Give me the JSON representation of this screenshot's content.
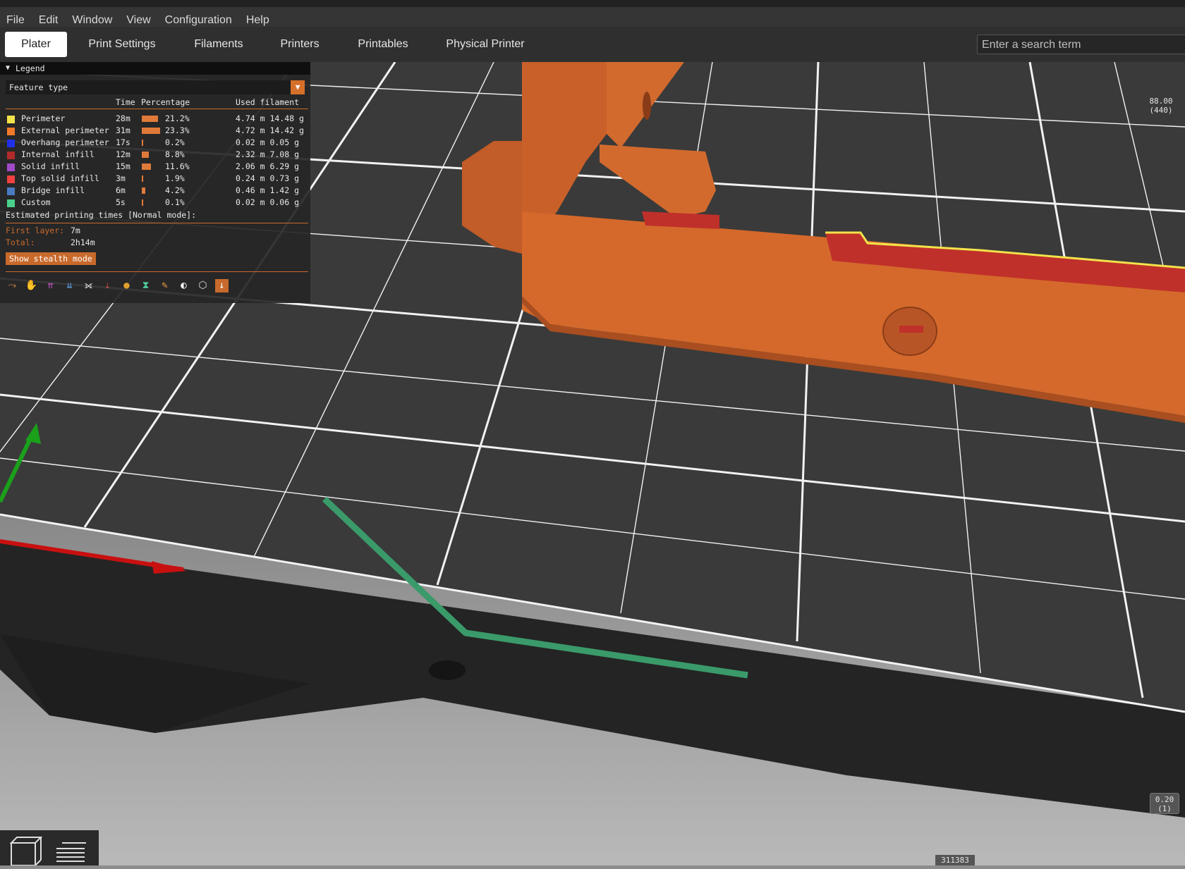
{
  "menu": [
    "File",
    "Edit",
    "Window",
    "View",
    "Configuration",
    "Help"
  ],
  "tabs": [
    "Plater",
    "Print Settings",
    "Filaments",
    "Printers",
    "Printables",
    "Physical Printer"
  ],
  "search": {
    "placeholder": "Enter a search term"
  },
  "legend": {
    "title": "Legend",
    "combo": "Feature type",
    "headers": {
      "time": "Time",
      "percentage": "Percentage",
      "used": "Used filament"
    },
    "rows": [
      {
        "name": "Perimeter",
        "time": "28m",
        "pct": "21.2%",
        "pct_value": 21.2,
        "filament": "4.74 m 14.48 g",
        "color": "#f2e34a"
      },
      {
        "name": "External perimeter",
        "time": "31m",
        "pct": "23.3%",
        "pct_value": 23.3,
        "filament": "4.72 m 14.42 g",
        "color": "#f07a2a"
      },
      {
        "name": "Overhang perimeter",
        "time": "17s",
        "pct": "0.2%",
        "pct_value": 0.2,
        "filament": "0.02 m 0.05 g",
        "color": "#2030e8"
      },
      {
        "name": "Internal infill",
        "time": "12m",
        "pct": "8.8%",
        "pct_value": 8.8,
        "filament": "2.32 m 7.08 g",
        "color": "#b02a2a"
      },
      {
        "name": "Solid infill",
        "time": "15m",
        "pct": "11.6%",
        "pct_value": 11.6,
        "filament": "2.06 m 6.29 g",
        "color": "#a04ac8"
      },
      {
        "name": "Top solid infill",
        "time": "3m",
        "pct": "1.9%",
        "pct_value": 1.9,
        "filament": "0.24 m 0.73 g",
        "color": "#f04040"
      },
      {
        "name": "Bridge infill",
        "time": "6m",
        "pct": "4.2%",
        "pct_value": 4.2,
        "filament": "0.46 m 1.42 g",
        "color": "#4a7ac0"
      },
      {
        "name": "Custom",
        "time": "5s",
        "pct": "0.1%",
        "pct_value": 0.1,
        "filament": "0.02 m 0.06 g",
        "color": "#4ad08a"
      }
    ],
    "estimated_title": "Estimated printing times [Normal mode]:",
    "first_layer_label": "First layer:",
    "first_layer_value": "7m",
    "total_label": "Total:",
    "total_value": "2h14m",
    "stealth_button": "Show stealth mode",
    "icons": [
      "travel-icon",
      "wipe-icon",
      "retractions-icon",
      "deretractions-icon",
      "seams-icon",
      "tool-changes-icon",
      "color-changes-icon",
      "pause-prints-icon",
      "custom-gcodes-icon",
      "center-of-gravity-icon",
      "shells-icon",
      "tool-marker-icon"
    ]
  },
  "slider": {
    "top_value": "88.00",
    "top_layer": "(440)",
    "bottom_value": "0.20",
    "bottom_layer": "(1)",
    "horizontal_count": "311383"
  },
  "colors": {
    "accent": "#d5702b",
    "model": "#d9692a",
    "bed_dark": "#2c2c2c"
  }
}
